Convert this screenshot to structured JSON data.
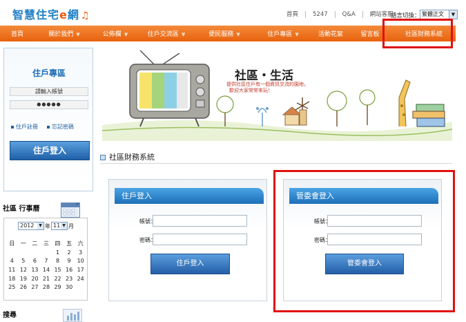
{
  "header": {
    "logo_text": "智慧住宅",
    "logo_e": "e",
    "logo_suffix": "網",
    "top_links": [
      "首頁",
      "5247",
      "Q&A",
      "網站客服"
    ],
    "lang_label": "語言切換：",
    "lang_value": "繁體正文"
  },
  "nav": {
    "items": [
      {
        "label": "首頁",
        "dropdown": false
      },
      {
        "label": "關於我們",
        "dropdown": true
      },
      {
        "label": "公佈欄",
        "dropdown": true
      },
      {
        "label": "住戶交流區",
        "dropdown": true
      },
      {
        "label": "便民服務",
        "dropdown": true
      },
      {
        "label": "住戶專區",
        "dropdown": true
      },
      {
        "label": "活動花絮",
        "dropdown": false
      },
      {
        "label": "留言板",
        "dropdown": false
      },
      {
        "label": "社區財務系統",
        "dropdown": false
      }
    ],
    "accent": "#ee7422"
  },
  "sidebar": {
    "login_title": "住戶專區",
    "account_placeholder": "請輸入帳號",
    "password_mask": "●●●●●",
    "register_link": "住戶註冊",
    "forgot_link": "忘記密碼",
    "login_button": "住戶登入",
    "calendar_title": "社區 行事曆",
    "calendar": {
      "year": "2012",
      "year_suffix": "年",
      "month": "11",
      "month_suffix": "月",
      "weekdays": [
        "日",
        "一",
        "二",
        "三",
        "四",
        "五",
        "六"
      ],
      "weeks": [
        [
          "",
          "",
          "",
          "",
          "1",
          "2",
          "3"
        ],
        [
          "4",
          "5",
          "6",
          "7",
          "8",
          "9",
          "10"
        ],
        [
          "11",
          "12",
          "13",
          "14",
          "15",
          "16",
          "17"
        ],
        [
          "18",
          "19",
          "20",
          "21",
          "22",
          "23",
          "24"
        ],
        [
          "25",
          "26",
          "27",
          "28",
          "29",
          "30",
          ""
        ]
      ]
    },
    "search_title": "搜尋"
  },
  "banner": {
    "title": "社區・生活",
    "subtitle_line1": "提供社區住戶有一個資訊交流的園地，",
    "subtitle_line2": "歡迎大家常常來玩！"
  },
  "main": {
    "section_title": "社區財務系統",
    "resident_panel": {
      "title": "住戶登入",
      "account_label": "帳號：",
      "password_label": "密碼：",
      "button": "住戶登入"
    },
    "committee_panel": {
      "title": "管委會登入",
      "account_label": "帳號：",
      "password_label": "密碼：",
      "button": "管委會登入"
    }
  },
  "highlight_color": "#e01010"
}
